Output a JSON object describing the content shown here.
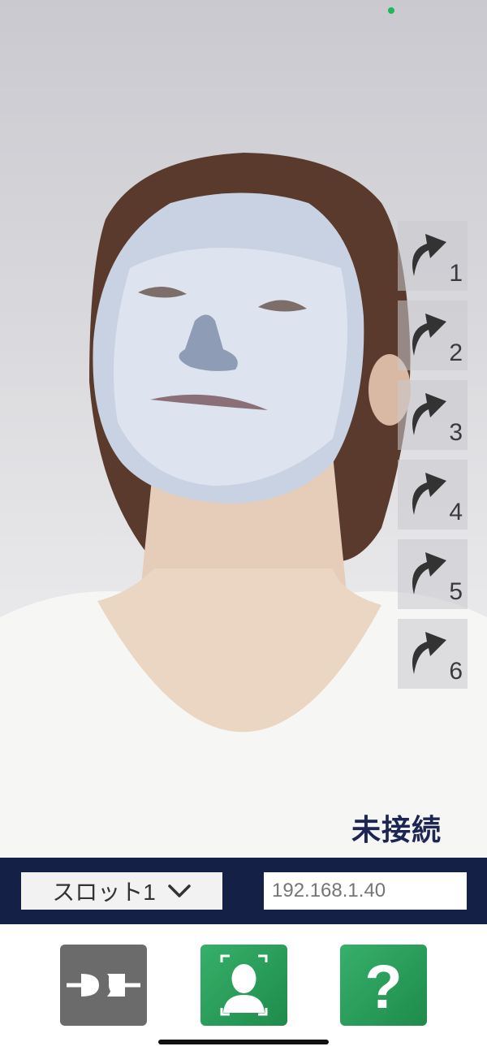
{
  "camera": {
    "status_dot_color": "#1db954"
  },
  "shortcuts": [
    {
      "label": "1",
      "icon": "curved-arrow-icon"
    },
    {
      "label": "2",
      "icon": "curved-arrow-icon"
    },
    {
      "label": "3",
      "icon": "curved-arrow-icon"
    },
    {
      "label": "4",
      "icon": "curved-arrow-icon"
    },
    {
      "label": "5",
      "icon": "curved-arrow-icon"
    },
    {
      "label": "6",
      "icon": "curved-arrow-icon"
    }
  ],
  "connection": {
    "status_text": "未接続"
  },
  "control_bar": {
    "slot_label": "スロット1",
    "ip_placeholder": "192.168.1.40",
    "background": "#142046"
  },
  "actions": {
    "connect_icon": "plug-icon",
    "face_icon": "face-scan-icon",
    "help_icon": "question-icon",
    "help_symbol": "?"
  }
}
